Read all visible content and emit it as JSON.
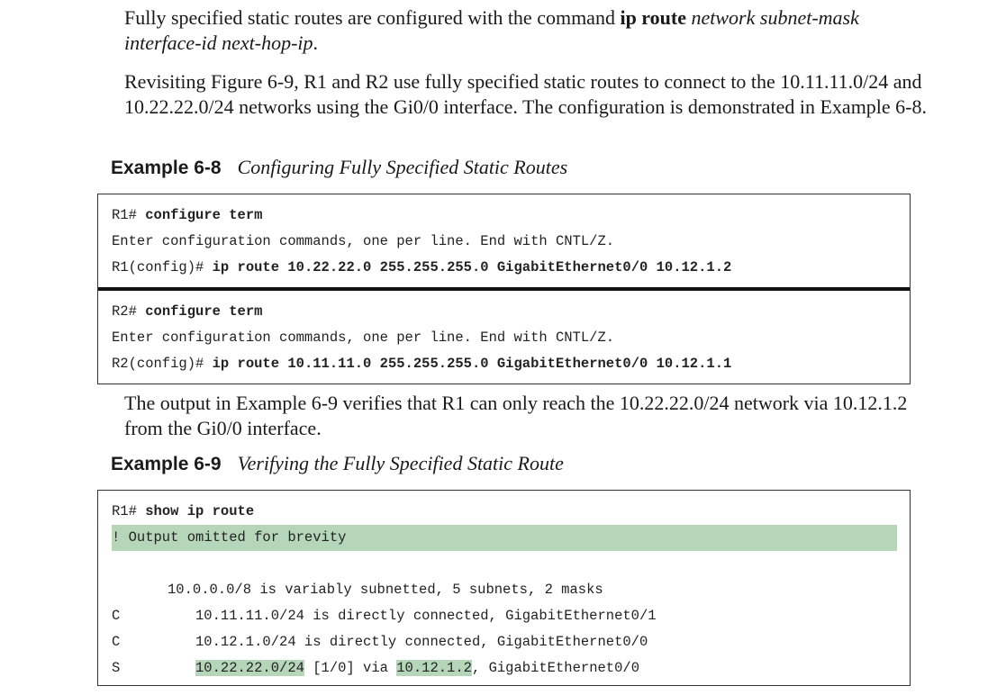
{
  "para1": {
    "t1": "Fully specified static routes are configured with the command ",
    "cmd": "ip route",
    "t2": " ",
    "args": "network subnet-mask interface-id next-hop-ip",
    "t3": "."
  },
  "para2": "Revisiting Figure 6-9, R1 and R2 use fully specified static routes to connect to the 10.11.11.0/24 and 10.22.22.0/24 networks using the Gi0/0 interface. The configuration is demonstrated in Example 6-8.",
  "example1": {
    "number": "Example 6-8",
    "caption": "Configuring Fully Specified Static Routes",
    "r1": {
      "prompt1": "R1# ",
      "cmd1": "configure term",
      "line2": "Enter configuration commands, one per line. End with CNTL/Z.",
      "prompt3": "R1(config)# ",
      "cmd3": "ip route 10.22.22.0 255.255.255.0 GigabitEthernet0/0 10.12.1.2"
    },
    "r2": {
      "prompt1": "R2# ",
      "cmd1": "configure term",
      "line2": "Enter configuration commands, one per line. End with CNTL/Z.",
      "prompt3": "R2(config)# ",
      "cmd3": "ip route 10.11.11.0 255.255.255.0 GigabitEthernet0/0 10.12.1.1"
    }
  },
  "para3": "The output in Example 6-9 verifies that R1 can only reach the 10.22.22.0/24 network via 10.12.1.2 from the Gi0/0 interface.",
  "example2": {
    "number": "Example 6-9",
    "caption": "Verifying the Fully Specified Static Route",
    "prompt1": "R1# ",
    "cmd1": "show ip route",
    "comment": "! Output omitted for brevity",
    "summary": "10.0.0.0/8 is variably subnetted, 5 subnets, 2 masks",
    "routes": [
      {
        "code": "C",
        "text": "10.11.11.0/24 is directly connected, GigabitEthernet0/1"
      },
      {
        "code": "C",
        "text": "10.12.1.0/24 is directly connected, GigabitEthernet0/0"
      }
    ],
    "static_route": {
      "code": "S",
      "network": "10.22.22.0/24",
      "mid": " [1/0] via ",
      "nexthop": "10.12.1.2",
      "tail": ", GigabitEthernet0/0"
    }
  },
  "colors": {
    "highlight": "#b5d6b9",
    "border": "#333333"
  }
}
